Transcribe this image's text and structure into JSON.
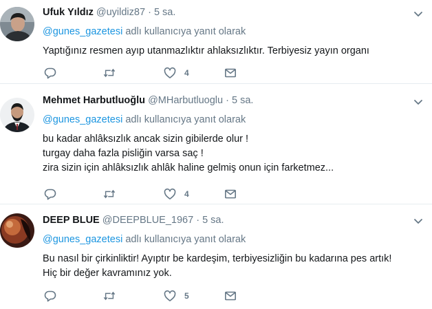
{
  "tweets": [
    {
      "fullname": "Ufuk Yıldız",
      "handle": "@uyildiz87",
      "time": "5 sa.",
      "reply_prefix": "@gunes_gazetesi",
      "reply_suffix": " adlı kullanıcıya yanıt olarak",
      "text": "Yaptığınız resmen ayıp utanmazlıktır ahlaksızlıktır. Terbiyesiz yayın organı",
      "likes": "4"
    },
    {
      "fullname": "Mehmet Harbutluoğlu",
      "handle": "@MHarbutluoglu",
      "time": "5 sa.",
      "reply_prefix": "@gunes_gazetesi",
      "reply_suffix": " adlı kullanıcıya yanıt olarak",
      "text": "bu kadar ahlâksızlık ancak sizin gibilerde olur !\nturgay daha fazla pisliğin varsa saç !\nzira sizin için ahlâksızlık ahlâk haline gelmiş onun için farketmez...",
      "likes": "4"
    },
    {
      "fullname": "DEEP BLUE",
      "handle": "@DEEPBLUE_1967",
      "time": "5 sa.",
      "reply_prefix": "@gunes_gazetesi",
      "reply_suffix": " adlı kullanıcıya yanıt olarak",
      "text": "Bu nasıl bir çirkinliktir! Ayıptır be kardeşim, terbiyesizliğin bu kadarına pes artık!\nHiç bir değer kavramınız yok.",
      "likes": "5"
    }
  ],
  "separator": "·",
  "icons": {
    "reply": "reply-icon",
    "retweet": "retweet-icon",
    "like": "heart-icon",
    "dm": "envelope-icon",
    "menu": "chevron-down-icon"
  },
  "colors": {
    "link": "#1b95e0",
    "secondary": "#657786",
    "text": "#14171a",
    "divider": "#e6ecf0"
  }
}
